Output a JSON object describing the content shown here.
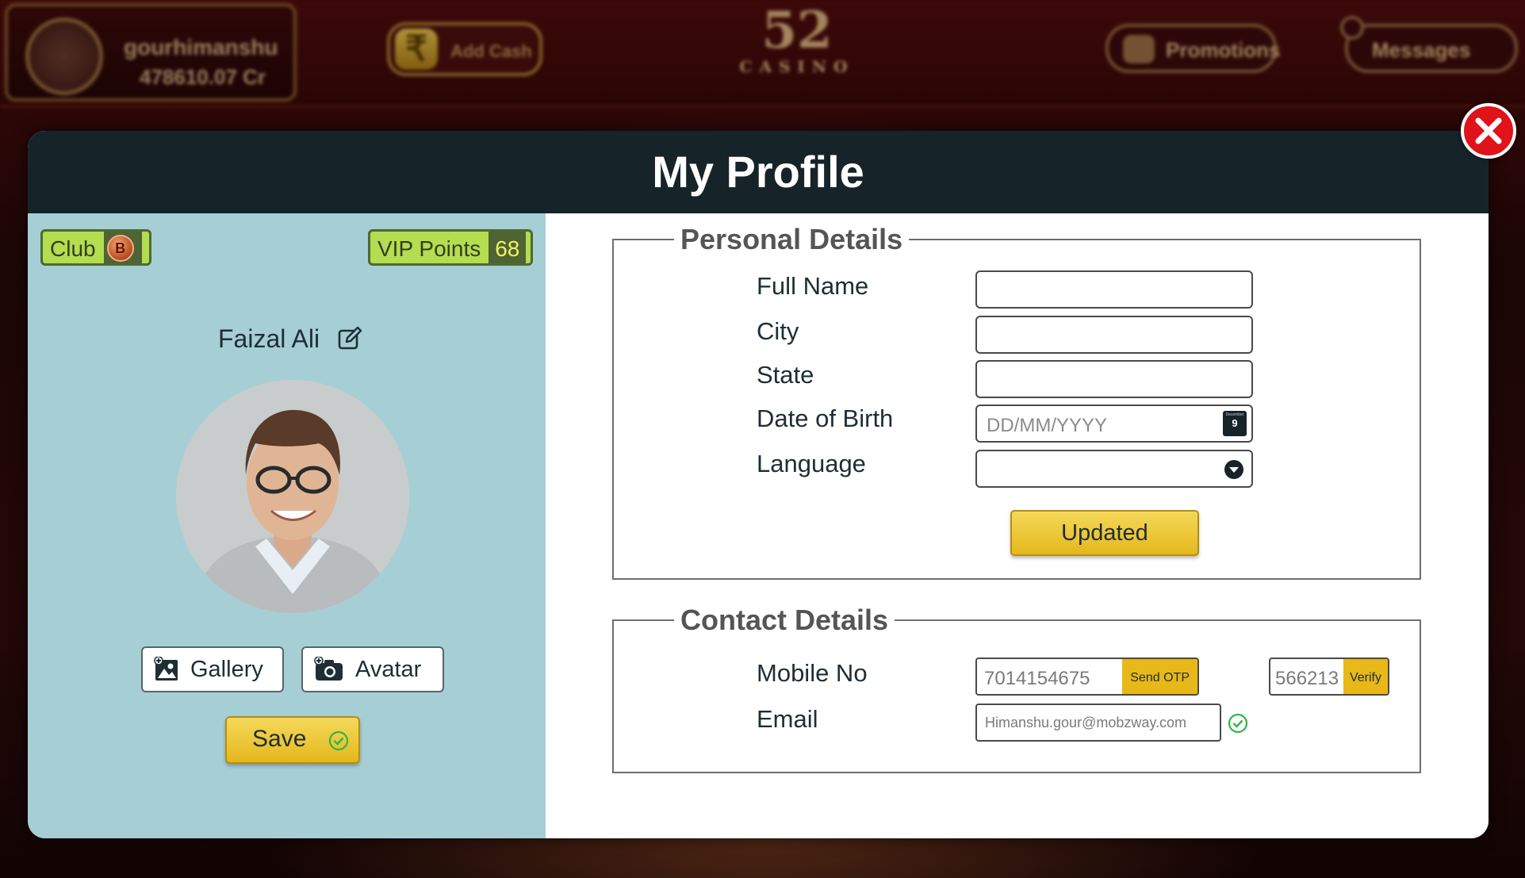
{
  "topbar": {
    "username": "gourhimanshu",
    "balance": "478610.07 Cr",
    "add_cash_label": "Add Cash",
    "rupee_symbol": "₹",
    "logo_number": "52",
    "logo_word": "CASINO",
    "promotions_label": "Promotions",
    "messages_label": "Messages"
  },
  "modal": {
    "title": "My Profile",
    "close_icon": "close-icon"
  },
  "profile": {
    "club_label": "Club",
    "club_level": "B",
    "vip_label": "VIP Points",
    "vip_value": "68",
    "name": "Faizal Ali",
    "gallery_label": "Gallery",
    "avatar_label": "Avatar",
    "save_label": "Save"
  },
  "personal": {
    "legend": "Personal Details",
    "full_name_label": "Full Name",
    "city_label": "City",
    "state_label": "State",
    "dob_label": "Date of Birth",
    "dob_placeholder": "DD/MM/YYYY",
    "calendar_month": "December",
    "calendar_day": "9",
    "language_label": "Language",
    "language_value": "",
    "update_label": "Updated"
  },
  "contact": {
    "legend": "Contact Details",
    "mobile_label": "Mobile No",
    "mobile_value": "7014154675",
    "send_otp_label": "Send OTP",
    "otp_value": "566213",
    "verify_label": "Verify",
    "email_label": "Email",
    "email_value": "Himanshu.gour@mobzway.com"
  },
  "colors": {
    "modal_header": "#16242a",
    "left_panel": "#a6ced5",
    "badge_green": "#b4dd50",
    "button_gold": "#e8b818",
    "close_red": "#e0121a",
    "check_green": "#2fb54a"
  }
}
